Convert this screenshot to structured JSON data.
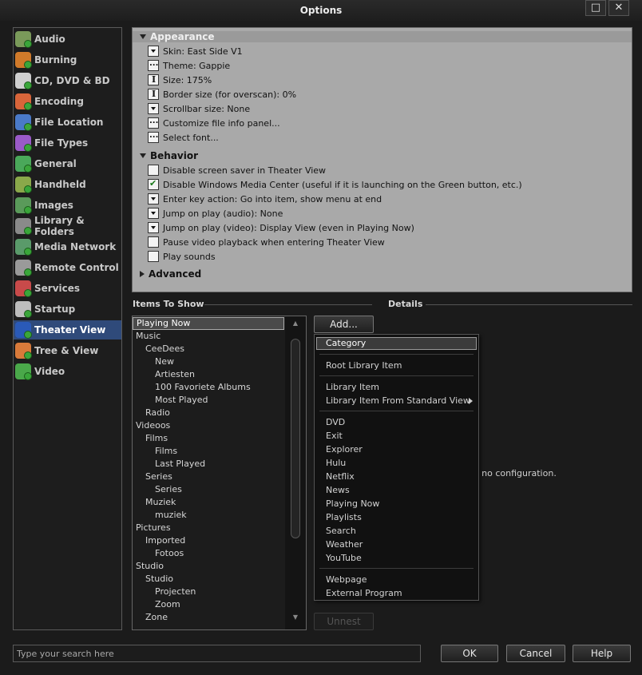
{
  "window": {
    "title": "Options",
    "maximize_icon": "maximize-icon",
    "close_icon": "close-icon",
    "close_glyph": "✕",
    "maximize_glyph": "□"
  },
  "sidebar": {
    "items": [
      {
        "label": "Audio",
        "icon": "audio-icon",
        "color": "#7a9a5a"
      },
      {
        "label": "Burning",
        "icon": "burning-icon",
        "color": "#d07a2a"
      },
      {
        "label": "CD, DVD & BD",
        "icon": "disc-icon",
        "color": "#cfcfcf"
      },
      {
        "label": "Encoding",
        "icon": "encoding-icon",
        "color": "#d8653a"
      },
      {
        "label": "File Location",
        "icon": "file-location-icon",
        "color": "#4a7ac8"
      },
      {
        "label": "File Types",
        "icon": "file-types-icon",
        "color": "#9a5ac8"
      },
      {
        "label": "General",
        "icon": "general-icon",
        "color": "#4aa85a"
      },
      {
        "label": "Handheld",
        "icon": "handheld-icon",
        "color": "#8aa84a"
      },
      {
        "label": "Images",
        "icon": "images-icon",
        "color": "#5a9a5a"
      },
      {
        "label": "Library & Folders",
        "icon": "library-icon",
        "color": "#8a8a8a"
      },
      {
        "label": "Media Network",
        "icon": "media-network-icon",
        "color": "#5a9a6a"
      },
      {
        "label": "Remote Control",
        "icon": "remote-control-icon",
        "color": "#9a9a9a"
      },
      {
        "label": "Services",
        "icon": "services-icon",
        "color": "#c84a4a"
      },
      {
        "label": "Startup",
        "icon": "startup-icon",
        "color": "#bdbdbd"
      },
      {
        "label": "Theater View",
        "icon": "theater-view-icon",
        "color": "#2a5ab8"
      },
      {
        "label": "Tree & View",
        "icon": "tree-view-icon",
        "color": "#d87a3a"
      },
      {
        "label": "Video",
        "icon": "video-icon",
        "color": "#4aa84a"
      }
    ],
    "selected": "Theater View"
  },
  "panel": {
    "appearance_label": "Appearance",
    "appearance_items": [
      {
        "type": "dd",
        "label": "Skin: East Side V1"
      },
      {
        "type": "el",
        "label": "Theme: Gappie"
      },
      {
        "type": "sp",
        "label": "Size: 175%"
      },
      {
        "type": "sp",
        "label": "Border size (for overscan): 0%"
      },
      {
        "type": "dd",
        "label": "Scrollbar size: None"
      },
      {
        "type": "el",
        "label": "Customize file info panel..."
      },
      {
        "type": "el",
        "label": "Select font..."
      }
    ],
    "behavior_label": "Behavior",
    "behavior_items": [
      {
        "type": "cb",
        "checked": false,
        "label": "Disable screen saver in Theater View"
      },
      {
        "type": "cb",
        "checked": true,
        "label": "Disable Windows Media Center (useful if it is launching on the Green button, etc.)"
      },
      {
        "type": "dd",
        "label": "Enter key action: Go into item, show menu at end"
      },
      {
        "type": "dd",
        "label": "Jump on play (audio): None"
      },
      {
        "type": "dd",
        "label": "Jump on play (video): Display View (even in Playing Now)"
      },
      {
        "type": "cb",
        "checked": false,
        "label": "Pause video playback when entering Theater View"
      },
      {
        "type": "cb",
        "checked": false,
        "label": "Play sounds"
      }
    ],
    "advanced_label": "Advanced"
  },
  "items_to_show": {
    "title": "Items To Show",
    "items": [
      {
        "label": "Playing Now",
        "level": 0,
        "selected": true
      },
      {
        "label": "Music",
        "level": 0
      },
      {
        "label": "CeeDees",
        "level": 1
      },
      {
        "label": "New",
        "level": 2
      },
      {
        "label": "Artiesten",
        "level": 2
      },
      {
        "label": "100 Favoriete Albums",
        "level": 2
      },
      {
        "label": "Most Played",
        "level": 2
      },
      {
        "label": "Radio",
        "level": 1
      },
      {
        "label": "Videoos",
        "level": 0
      },
      {
        "label": "Films",
        "level": 1
      },
      {
        "label": "Films",
        "level": 2
      },
      {
        "label": "Last Played",
        "level": 2
      },
      {
        "label": "Series",
        "level": 1
      },
      {
        "label": "Series",
        "level": 2
      },
      {
        "label": "Muziek",
        "level": 1
      },
      {
        "label": "muziek",
        "level": 2
      },
      {
        "label": "Pictures",
        "level": 0
      },
      {
        "label": "Imported",
        "level": 1
      },
      {
        "label": "Fotoos",
        "level": 2
      },
      {
        "label": "Studio",
        "level": 0
      },
      {
        "label": "Studio",
        "level": 1
      },
      {
        "label": "Projecten",
        "level": 2
      },
      {
        "label": "Zoom",
        "level": 2
      },
      {
        "label": "Zone",
        "level": 1
      }
    ],
    "scroll_up": "▲",
    "scroll_down": "▼"
  },
  "details": {
    "title": "Details",
    "add_button": "Add...",
    "no_config_text": "m has no configuration.",
    "unnest_button": "Unnest"
  },
  "add_menu": {
    "groups": [
      [
        "Category"
      ],
      [
        "Root Library Item"
      ],
      [
        "Library Item",
        "Library Item From Standard View"
      ],
      [
        "DVD",
        "Exit",
        "Explorer",
        "Hulu",
        "Netflix",
        "News",
        "Playing Now",
        "Playlists",
        "Search",
        "Weather",
        "YouTube"
      ],
      [
        "Webpage",
        "External Program"
      ]
    ],
    "highlighted": "Category",
    "has_submenu": "Library Item From Standard View"
  },
  "footer": {
    "search_placeholder": "Type your search here",
    "ok": "OK",
    "cancel": "Cancel",
    "help": "Help"
  }
}
